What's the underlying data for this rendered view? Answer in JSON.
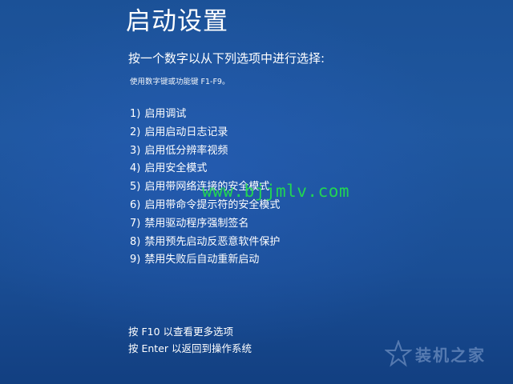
{
  "screen": {
    "title": "启动设置",
    "prompt": "按一个数字以从下列选项中进行选择:",
    "hint": "使用数字键或功能键 F1-F9。",
    "options": [
      {
        "number": "1)",
        "label": "启用调试"
      },
      {
        "number": "2)",
        "label": "启用启动日志记录"
      },
      {
        "number": "3)",
        "label": "启用低分辨率视频"
      },
      {
        "number": "4)",
        "label": "启用安全模式"
      },
      {
        "number": "5)",
        "label": "启用带网络连接的安全模式"
      },
      {
        "number": "6)",
        "label": "启用带命令提示符的安全模式"
      },
      {
        "number": "7)",
        "label": "禁用驱动程序强制签名"
      },
      {
        "number": "8)",
        "label": "禁用预先启动反恶意软件保护"
      },
      {
        "number": "9)",
        "label": "禁用失败后自动重新启动"
      }
    ],
    "footer": {
      "more_options": "按 F10 以查看更多选项",
      "return": "按 Enter 以返回到操作系统"
    }
  },
  "watermark": {
    "url": "www.bjjmlv.com",
    "brand": "装机之家",
    "url_color": "#22e34a"
  },
  "colors": {
    "background": "#1f579f",
    "text": "#ffffff"
  },
  "icons": {
    "brand_mark": "star-logo-icon"
  }
}
